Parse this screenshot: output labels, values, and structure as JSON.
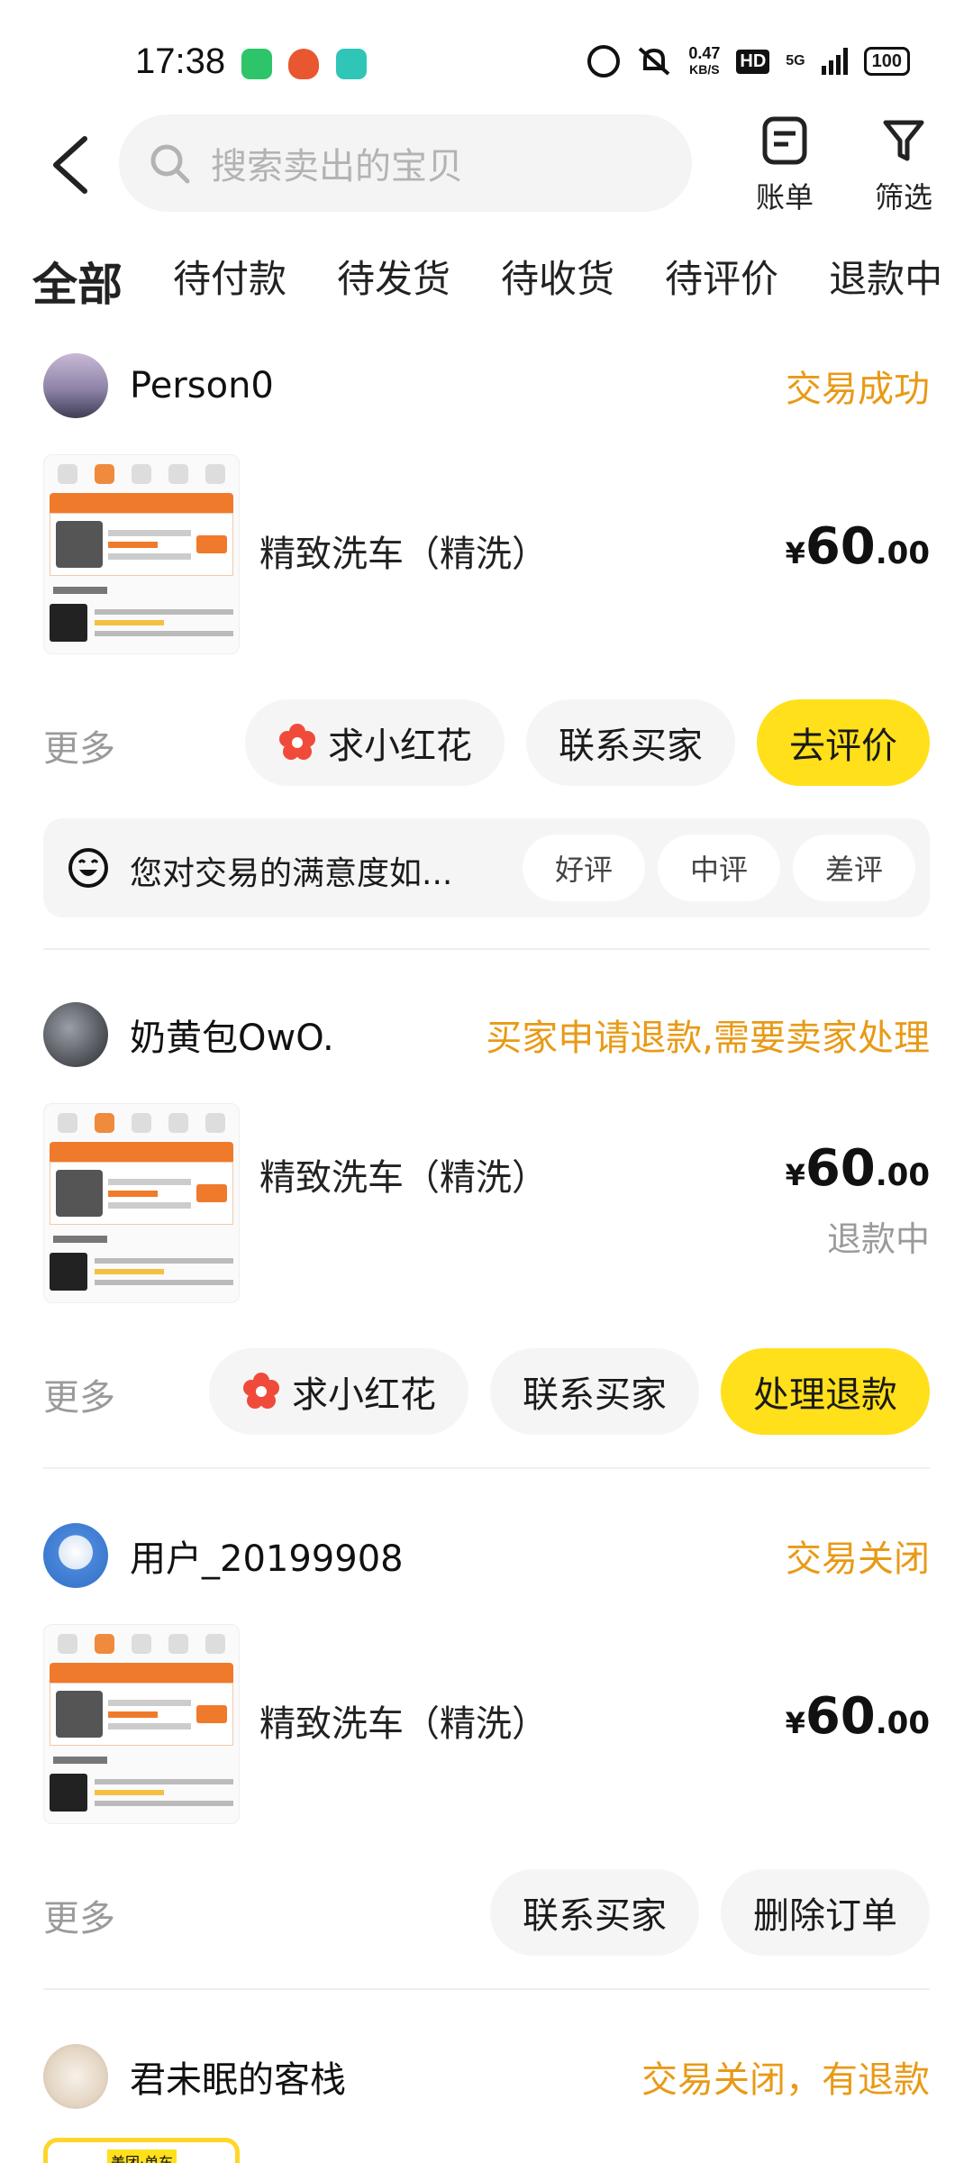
{
  "status_bar": {
    "time": "17:38",
    "net_speed_value": "0.47",
    "net_speed_unit": "KB/S",
    "hd": "HD",
    "network": "5G",
    "battery": "100"
  },
  "header": {
    "search_placeholder": "搜索卖出的宝贝",
    "bill_label": "账单",
    "filter_label": "筛选"
  },
  "tabs": [
    {
      "label": "全部",
      "active": true
    },
    {
      "label": "待付款"
    },
    {
      "label": "待发货"
    },
    {
      "label": "待收货"
    },
    {
      "label": "待评价"
    },
    {
      "label": "退款中"
    }
  ],
  "orders": [
    {
      "buyer": "Person0",
      "status": "交易成功",
      "title": "精致洗车（精洗）",
      "price_currency": "¥",
      "price_int": "60",
      "price_dec": ".00",
      "more": "更多",
      "buttons": [
        "求小红花",
        "联系买家",
        "去评价"
      ],
      "rating_question": "您对交易的满意度如...",
      "rating_options": [
        "好评",
        "中评",
        "差评"
      ]
    },
    {
      "buyer": "奶黄包OwO.",
      "status": "买家申请退款,需要卖家处理",
      "title": "精致洗车（精洗）",
      "price_currency": "¥",
      "price_int": "60",
      "price_dec": ".00",
      "sub_status": "退款中",
      "more": "更多",
      "buttons": [
        "求小红花",
        "联系买家",
        "处理退款"
      ]
    },
    {
      "buyer": "用户_20199908",
      "status": "交易关闭",
      "title": "精致洗车（精洗）",
      "price_currency": "¥",
      "price_int": "60",
      "price_dec": ".00",
      "more": "更多",
      "buttons": [
        "联系买家",
        "删除订单"
      ]
    },
    {
      "buyer": "君未眠的客栈",
      "status": "交易关闭，有退款",
      "thumb_tag": "美团·单车"
    }
  ],
  "colors": {
    "accent_yellow": "#ffe01b",
    "status_orange": "#e89a16",
    "muted_gray": "#9a9a9a"
  }
}
